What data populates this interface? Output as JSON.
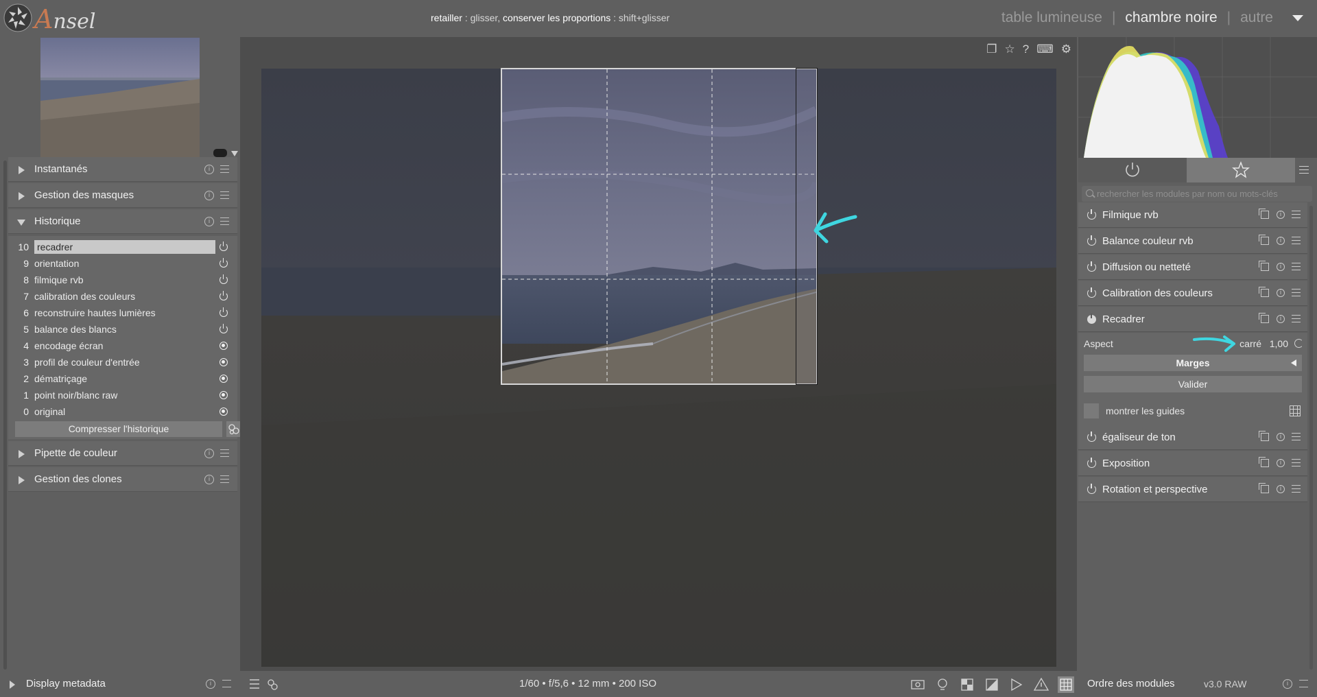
{
  "app": {
    "name": "nsel"
  },
  "hint": {
    "part1": "retailler",
    "part2": " : glisser, ",
    "part3": "conserver les proportions",
    "part4": " : shift+glisser"
  },
  "views": {
    "lighttable": "table lumineuse",
    "darkroom": "chambre noire",
    "other": "autre"
  },
  "left_panel": {
    "sections": {
      "snapshots": "Instantanés",
      "masks": "Gestion des masques",
      "history": "Historique",
      "colorpicker": "Pipette de couleur",
      "clones": "Gestion des clones"
    },
    "history": [
      {
        "num": "10",
        "name": "recadrer",
        "state": "power"
      },
      {
        "num": "9",
        "name": "orientation",
        "state": "power"
      },
      {
        "num": "8",
        "name": "filmique rvb",
        "state": "power"
      },
      {
        "num": "7",
        "name": "calibration des couleurs",
        "state": "power"
      },
      {
        "num": "6",
        "name": "reconstruire hautes lumières",
        "state": "power"
      },
      {
        "num": "5",
        "name": "balance des blancs",
        "state": "power"
      },
      {
        "num": "4",
        "name": "encodage écran",
        "state": "always-on"
      },
      {
        "num": "3",
        "name": "profil de couleur d'entrée",
        "state": "always-on"
      },
      {
        "num": "2",
        "name": "dématriçage",
        "state": "always-on"
      },
      {
        "num": "1",
        "name": "point noir/blanc raw",
        "state": "always-on"
      },
      {
        "num": "0",
        "name": "original",
        "state": "always-on"
      }
    ],
    "compress_label": "Compresser l'historique",
    "display_metadata": "Display metadata"
  },
  "center": {
    "exif": "1/60 • f/5,6 • 12 mm • 200 ISO"
  },
  "right_panel": {
    "search_placeholder": "rechercher les modules par nom ou mots-clés",
    "modules_top": [
      "Filmique rvb",
      "Balance couleur rvb",
      "Diffusion ou netteté",
      "Calibration des couleurs",
      "Recadrer"
    ],
    "crop": {
      "aspect_label": "Aspect",
      "aspect_value": "carré",
      "aspect_ratio": "1,00",
      "margins_label": "Marges",
      "validate_label": "Valider",
      "guides_label": "montrer les guides"
    },
    "modules_bottom": [
      "égaliseur de ton",
      "Exposition",
      "Rotation et perspective"
    ],
    "order_label": "Ordre des modules",
    "order_value": "v3.0 RAW"
  },
  "colors": {
    "annotation": "#3fd6e0"
  }
}
